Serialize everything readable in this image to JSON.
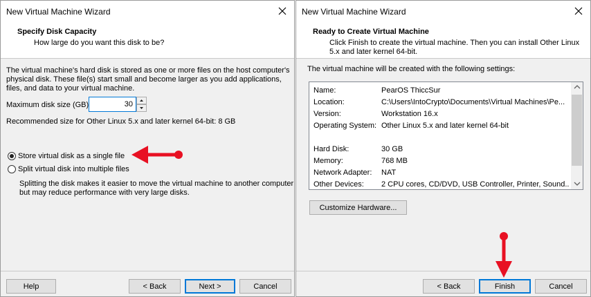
{
  "colors": {
    "arrow": "#e81123",
    "accent": "#0078d7"
  },
  "left": {
    "title": "New Virtual Machine Wizard",
    "header_title": "Specify Disk Capacity",
    "header_subtitle": "How large do you want this disk to be?",
    "intro_lines": [
      "The virtual machine's hard disk is stored as one or more files on the host computer's",
      "physical disk. These file(s) start small and become larger as you add applications,",
      "files, and data to your virtual machine."
    ],
    "max_size_label": "Maximum disk size (GB):",
    "max_size_value": "30",
    "recommended": "Recommended size for Other Linux 5.x and later kernel 64-bit: 8 GB",
    "radio_single": "Store virtual disk as a single file",
    "radio_multiple": "Split virtual disk into multiple files",
    "split_note_lines": [
      "Splitting the disk makes it easier to move the virtual machine to another computer",
      "but may reduce performance with very large disks."
    ],
    "buttons": {
      "help": "Help",
      "back": "< Back",
      "next": "Next >",
      "cancel": "Cancel"
    }
  },
  "right": {
    "title": "New Virtual Machine Wizard",
    "header_title": "Ready to Create Virtual Machine",
    "header_subtitle_lines": [
      "Click Finish to create the virtual machine. Then you can install Other Linux",
      "5.x and later kernel 64-bit."
    ],
    "intro": "The virtual machine will be created with the following settings:",
    "settings": [
      {
        "label": "Name:",
        "value": "PearOS ThiccSur"
      },
      {
        "label": "Location:",
        "value": "C:\\Users\\IntoCrypto\\Documents\\Virtual Machines\\Pe..."
      },
      {
        "label": "Version:",
        "value": "Workstation 16.x"
      },
      {
        "label": "Operating System:",
        "value": "Other Linux 5.x and later kernel 64-bit"
      },
      {
        "label": "Hard Disk:",
        "value": "30 GB"
      },
      {
        "label": "Memory:",
        "value": "768 MB"
      },
      {
        "label": "Network Adapter:",
        "value": "NAT"
      },
      {
        "label": "Other Devices:",
        "value": "2 CPU cores, CD/DVD, USB Controller, Printer, Sound..."
      }
    ],
    "buttons": {
      "customize": "Customize Hardware...",
      "back": "< Back",
      "finish": "Finish",
      "cancel": "Cancel"
    }
  }
}
